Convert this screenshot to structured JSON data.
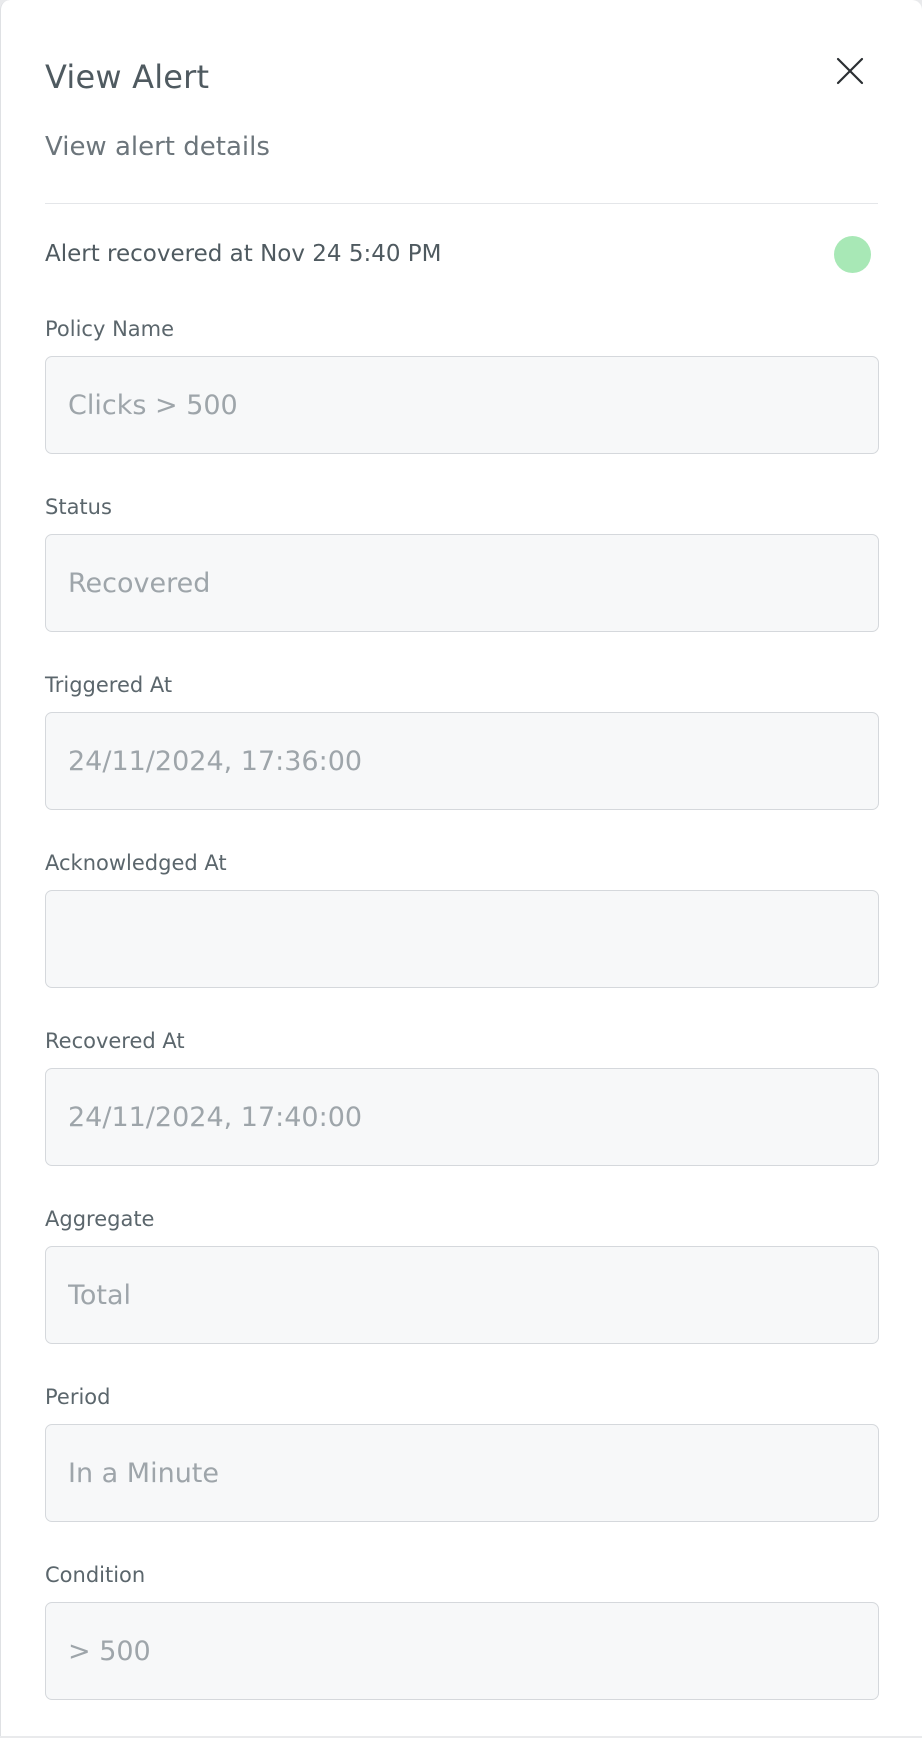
{
  "header": {
    "title": "View Alert",
    "subtitle": "View alert details"
  },
  "status": {
    "text": "Alert recovered at Nov 24 5:40 PM",
    "dot_color": "#a8e8b6"
  },
  "fields": [
    {
      "label": "Policy Name",
      "value": "Clicks > 500"
    },
    {
      "label": "Status",
      "value": "Recovered"
    },
    {
      "label": "Triggered At",
      "value": "24/11/2024, 17:36:00"
    },
    {
      "label": "Acknowledged At",
      "value": ""
    },
    {
      "label": "Recovered At",
      "value": "24/11/2024, 17:40:00"
    },
    {
      "label": "Aggregate",
      "value": "Total"
    },
    {
      "label": "Period",
      "value": "In a Minute"
    },
    {
      "label": "Condition",
      "value": "> 500"
    }
  ],
  "icons": {
    "close": "close-icon"
  }
}
